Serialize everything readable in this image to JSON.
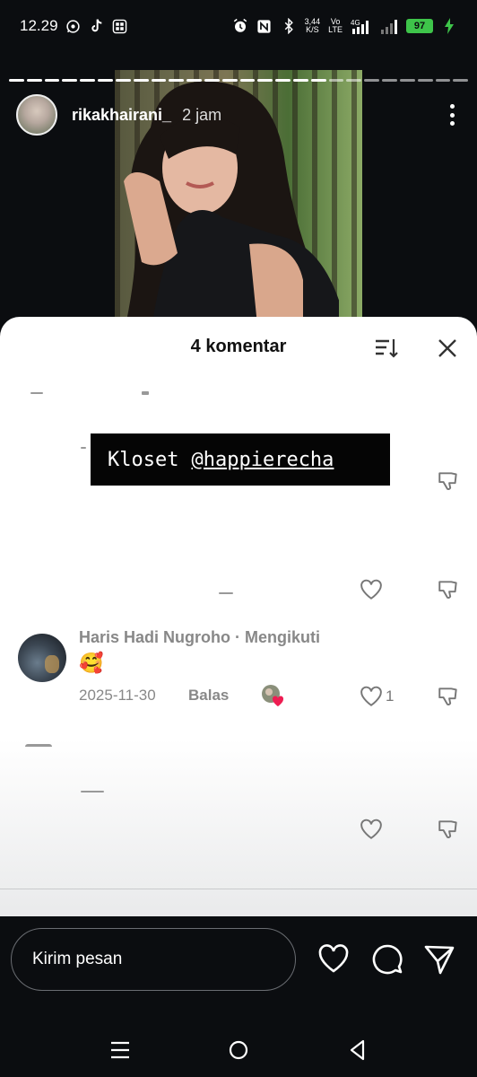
{
  "status_bar": {
    "time": "12.29",
    "network_speed": "3,44",
    "network_speed_unit": "K/S",
    "volte": "Vo",
    "lte": "LTE",
    "signal_type": "4G",
    "battery_percent": "97",
    "battery_color": "#3ec44a"
  },
  "story": {
    "username": "rikakhairani_",
    "time_ago": "2 jam",
    "progress_segments_total": 26,
    "progress_segments_done": 18
  },
  "comments_sheet": {
    "title": "4 komentar",
    "overlay_label_prefix": "Kloset",
    "overlay_label_mention": "@happierecha",
    "comment": {
      "author": "Haris Hadi Nugroho · Mengikuti",
      "text": "🥰",
      "date": "2025-11-30",
      "reply_label": "Balas",
      "likes": "1"
    }
  },
  "bottom_bar": {
    "message_placeholder": "Kirim pesan"
  },
  "icons": {
    "sort": "sort-icon",
    "close": "close-icon",
    "heart": "heart-icon",
    "dislike": "thumbs-down-icon",
    "comment": "comment-icon",
    "send": "send-icon"
  }
}
